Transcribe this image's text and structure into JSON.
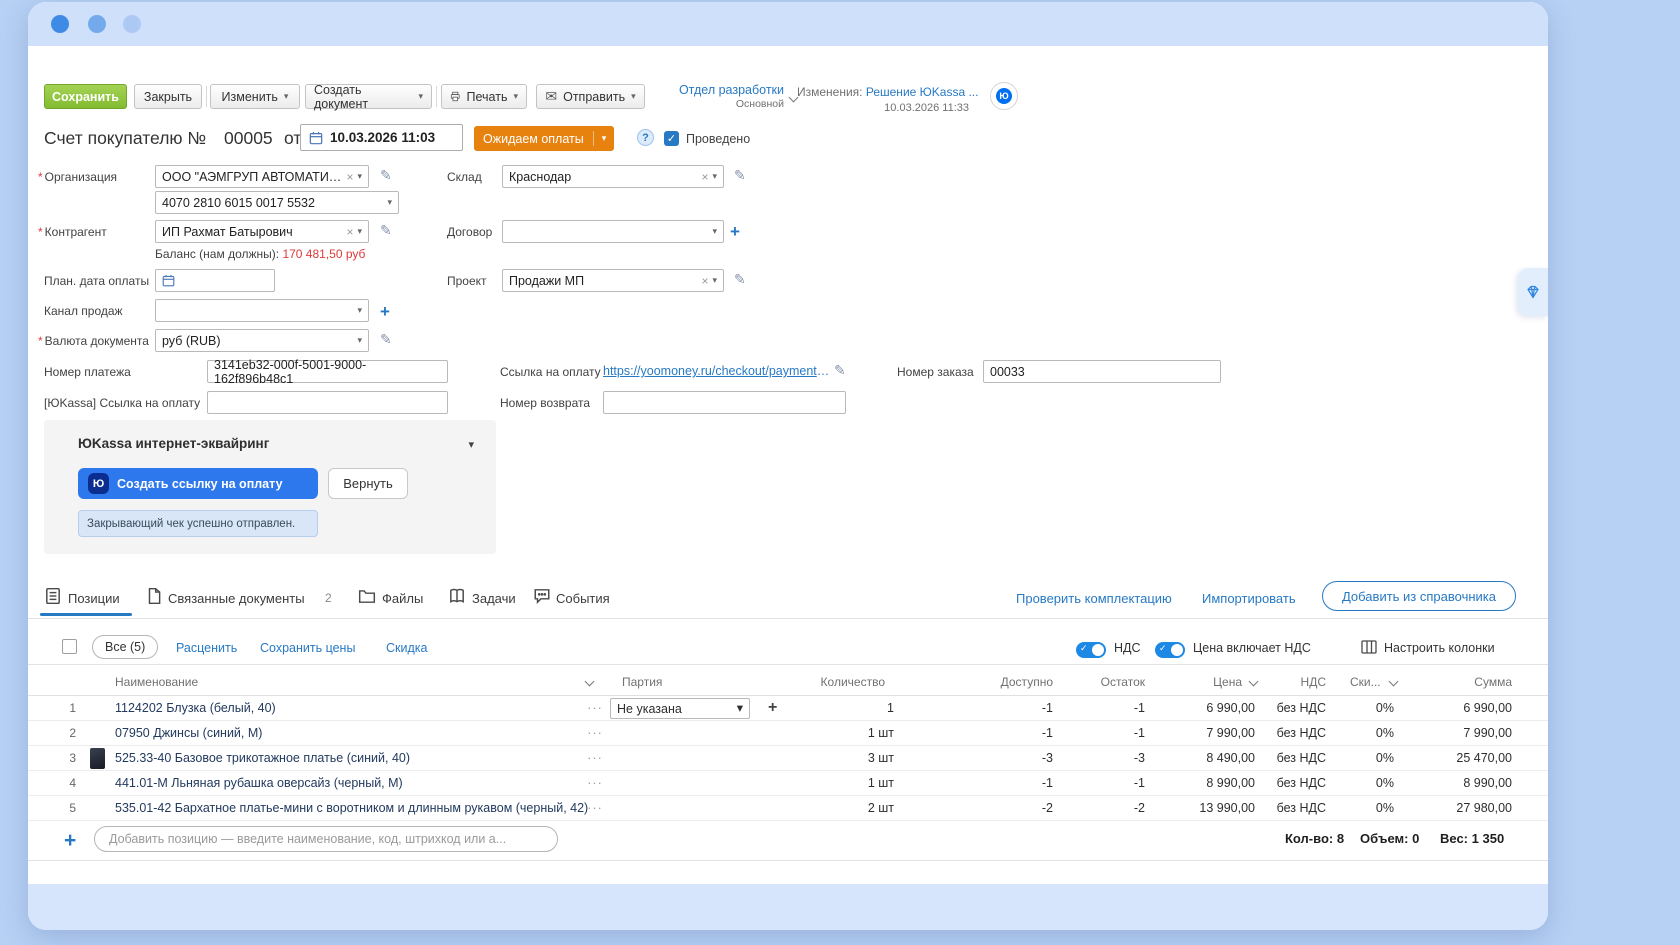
{
  "colors": {
    "accent_blue": "#2779c4",
    "save_green": "#8bc540",
    "status_orange": "#e8820f",
    "balance_red": "#e03a3a",
    "toggle_blue": "#1e88e5",
    "page_background": "#b7d1f5"
  },
  "icons": {
    "caret_down": "▾",
    "pencil": "✎",
    "envelope": "✉",
    "clear": "×",
    "plus": "+",
    "check": "✓",
    "ellipsis": "···",
    "help": "?",
    "required": "*",
    "yookassa_logo": "Ю"
  },
  "toolbar": {
    "save": "Сохранить",
    "close": "Закрыть",
    "edit": "Изменить",
    "create_doc": "Создать документ",
    "print": "Печать",
    "send": "Отправить"
  },
  "context": {
    "department": "Отдел разработки",
    "department_sub": "Основной",
    "changes_label": "Изменения:",
    "changes_link": "Решение ЮKassa ...",
    "changes_date": "10.03.2026 11:33"
  },
  "doc": {
    "title": "Счет покупателю №",
    "number": "00005",
    "of_label": "от",
    "date": "10.03.2026 11:03",
    "status": "Ожидаем оплаты",
    "posted": "Проведено"
  },
  "fields": {
    "org": {
      "label": "Организация",
      "value": "ООО \"АЭМГРУП АВТОМАТИЗАЦИ"
    },
    "account": {
      "value": "4070 2810 6015 0017 5532"
    },
    "contragent": {
      "label": "Контрагент",
      "value": "ИП Рахмат Батырович"
    },
    "balance": {
      "label": "Баланс (нам должны):",
      "value": "170 481,50 руб"
    },
    "plan_date": {
      "label": "План. дата оплаты"
    },
    "channel": {
      "label": "Канал продаж"
    },
    "currency": {
      "label": "Валюта документа",
      "value": "руб (RUB)"
    },
    "warehouse": {
      "label": "Склад",
      "value": "Краснодар"
    },
    "contract": {
      "label": "Договор"
    },
    "project": {
      "label": "Проект",
      "value": "Продажи МП"
    },
    "payment_number": {
      "label": "Номер платежа",
      "value": "3141eb32-000f-5001-9000-162f896b48c1"
    },
    "payment_link": {
      "label": "Ссылка на оплату",
      "value": "https://yoomoney.ru/checkout/payments…"
    },
    "order_number": {
      "label": "Номер заказа",
      "value": "00033"
    },
    "yk_link": {
      "label": "[ЮKassa] Ссылка на оплату"
    },
    "refund_number": {
      "label": "Номер возврата"
    }
  },
  "yookassa": {
    "title": "ЮKassa интернет-эквайринг",
    "create_btn": "Создать ссылку на оплату",
    "refund_btn": "Вернуть",
    "notice": "Закрывающий чек успешно отправлен."
  },
  "tabs": {
    "items": [
      {
        "label": "Позиции"
      },
      {
        "label": "Связанные документы",
        "badge": "2"
      },
      {
        "label": "Файлы"
      },
      {
        "label": "Задачи"
      },
      {
        "label": "События"
      }
    ],
    "check_link": "Проверить комплектацию",
    "import_link": "Импортировать",
    "add_btn": "Добавить из справочника"
  },
  "grid_toolbar": {
    "all": "Все (5)",
    "reprice": "Расценить",
    "save_prices": "Сохранить цены",
    "discount": "Скидка",
    "vat": "НДС",
    "price_incl_vat": "Цена включает НДС",
    "columns": "Настроить колонки"
  },
  "grid": {
    "headers": {
      "name": "Наименование",
      "batch": "Партия",
      "qty": "Количество",
      "avail": "Доступно",
      "stock": "Остаток",
      "price": "Цена",
      "vat": "НДС",
      "disc": "Ски...",
      "sum": "Сумма"
    },
    "rows": [
      {
        "n": "1",
        "name": "1124202 Блузка (белый, 40)",
        "batch": "Не указана",
        "qty": "1",
        "avail": "-1",
        "stock": "-1",
        "price": "6 990,00",
        "vat": "без НДС",
        "disc": "0%",
        "sum": "6 990,00"
      },
      {
        "n": "2",
        "name": "07950 Джинсы (синий, М)",
        "qty": "1 шт",
        "avail": "-1",
        "stock": "-1",
        "price": "7 990,00",
        "vat": "без НДС",
        "disc": "0%",
        "sum": "7 990,00"
      },
      {
        "n": "3",
        "name": "525.33-40 Базовое трикотажное платье (синий, 40)",
        "qty": "3 шт",
        "avail": "-3",
        "stock": "-3",
        "price": "8 490,00",
        "vat": "без НДС",
        "disc": "0%",
        "sum": "25 470,00"
      },
      {
        "n": "4",
        "name": "441.01-М Льняная рубашка оверсайз (черный, М)",
        "qty": "1 шт",
        "avail": "-1",
        "stock": "-1",
        "price": "8 990,00",
        "vat": "без НДС",
        "disc": "0%",
        "sum": "8 990,00"
      },
      {
        "n": "5",
        "name": "535.01-42 Бархатное платье-мини с воротником и длинным рукавом (черный, 42)",
        "qty": "2 шт",
        "avail": "-2",
        "stock": "-2",
        "price": "13 990,00",
        "vat": "без НДС",
        "disc": "0%",
        "sum": "27 980,00"
      }
    ]
  },
  "footer": {
    "placeholder": "Добавить позицию — введите наименование, код, штрихкод или а...",
    "qty_label": "Кол-во:",
    "qty": "8",
    "volume_label": "Объем:",
    "volume": "0",
    "weight_label": "Вес:",
    "weight": "1 350"
  }
}
